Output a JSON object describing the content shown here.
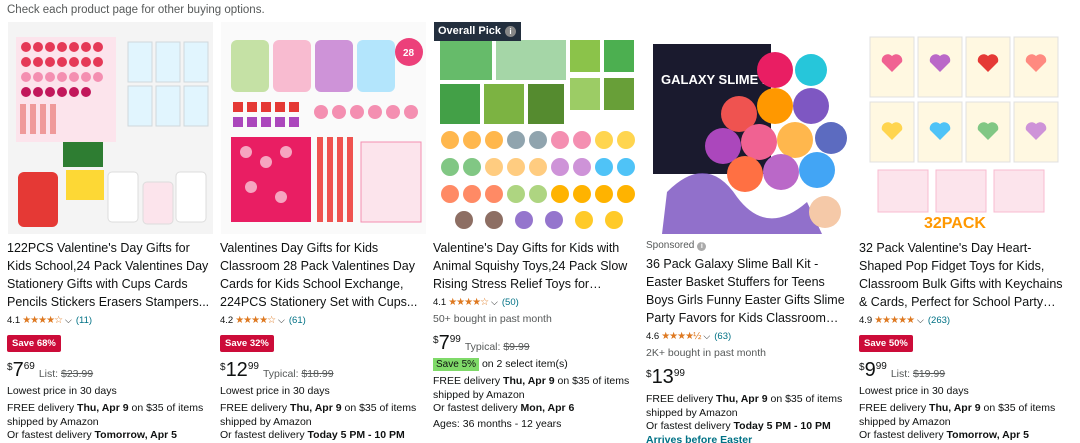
{
  "notice": "Check each product page for other buying options.",
  "products": [
    {
      "title": "122PCS Valentine's Day Gifts for Kids School,24 Pack Valentines Day Stationery Gifts with Cups Cards Pencils Stickers Erasers Stampers...",
      "rating": "4.1",
      "stars": "★★★★☆",
      "review_count": "(11)",
      "save_badge": "Save 68%",
      "price_symbol": "$",
      "price_whole": "7",
      "price_fraction": "69",
      "list_label": "List:",
      "list_price": "$23.99",
      "lowest": "Lowest price in 30 days",
      "delivery_1a": "FREE delivery ",
      "delivery_1b": "Thu, Apr 9",
      "delivery_1c": " on $35 of items shipped by Amazon",
      "delivery_2a": "Or fastest delivery ",
      "delivery_2b": "Tomorrow, Apr 5"
    },
    {
      "title": "Valentines Day Gifts for Kids Classroom 28 Pack Valentines Day Cards for Kids School Exchange, 224PCS Stationery Set with Cups...",
      "rating": "4.2",
      "stars": "★★★★☆",
      "review_count": "(61)",
      "save_badge": "Save 32%",
      "price_symbol": "$",
      "price_whole": "12",
      "price_fraction": "99",
      "list_label": "Typical:",
      "list_price": "$18.99",
      "lowest": "Lowest price in 30 days",
      "delivery_1a": "FREE delivery ",
      "delivery_1b": "Thu, Apr 9",
      "delivery_1c": " on $35 of items shipped by Amazon",
      "delivery_2a": "Or fastest delivery ",
      "delivery_2b": "Today 5 PM - 10 PM"
    },
    {
      "badge": "Overall Pick",
      "title": "Valentine's Day Gifts for Kids with Animal Squishy Toys,24 Pack Slow Rising Stress Relief Toys for Classroom Exchange Prizes,School...",
      "rating": "4.1",
      "stars": "★★★★☆",
      "review_count": "(50)",
      "bought": "50+ bought in past month",
      "price_symbol": "$",
      "price_whole": "7",
      "price_fraction": "99",
      "list_label": "Typical:",
      "list_price": "$9.99",
      "coupon_tag": "Save 5%",
      "coupon_text": " on 2 select item(s)",
      "delivery_1a": "FREE delivery ",
      "delivery_1b": "Thu, Apr 9",
      "delivery_1c": " on $35 of items shipped by Amazon",
      "delivery_2a": "Or fastest delivery ",
      "delivery_2b": "Mon, Apr 6",
      "age": "Ages: 36 months - 12 years"
    },
    {
      "sponsored": "Sponsored",
      "title": "36 Pack Galaxy Slime Ball Kit - Easter Basket Stuffers for Teens Boys Girls Funny Easter Gifts Slime Party Favors for Kids Classroom Reward Stress...",
      "rating": "4.6",
      "stars": "★★★★½",
      "review_count": "(63)",
      "bought": "2K+ bought in past month",
      "price_symbol": "$",
      "price_whole": "13",
      "price_fraction": "99",
      "delivery_1a": "FREE delivery ",
      "delivery_1b": "Thu, Apr 9",
      "delivery_1c": " on $35 of items shipped by Amazon",
      "delivery_2a": "Or fastest delivery ",
      "delivery_2b": "Today 5 PM - 10 PM",
      "arrives": "Arrives before Easter",
      "image_label": "GALAXY SLIME BALL"
    },
    {
      "title": "32 Pack Valentine's Day Heart-Shaped Pop Fidget Toys for Kids, Classroom Bulk Gifts with Keychains & Cards, Perfect for School Party &...",
      "rating": "4.9",
      "stars": "★★★★★",
      "review_count": "(263)",
      "save_badge": "Save 50%",
      "price_symbol": "$",
      "price_whole": "9",
      "price_fraction": "99",
      "list_label": "List:",
      "list_price": "$19.99",
      "lowest": "Lowest price in 30 days",
      "delivery_1a": "FREE delivery ",
      "delivery_1b": "Thu, Apr 9",
      "delivery_1c": " on $35 of items shipped by Amazon",
      "delivery_2a": "Or fastest delivery ",
      "delivery_2b": "Tomorrow, Apr 5",
      "image_label": "32PACK"
    }
  ],
  "colors": {
    "star": "#de7921",
    "save_badge": "#cc0c39",
    "link": "#007185",
    "coupon": "#7fda69"
  }
}
